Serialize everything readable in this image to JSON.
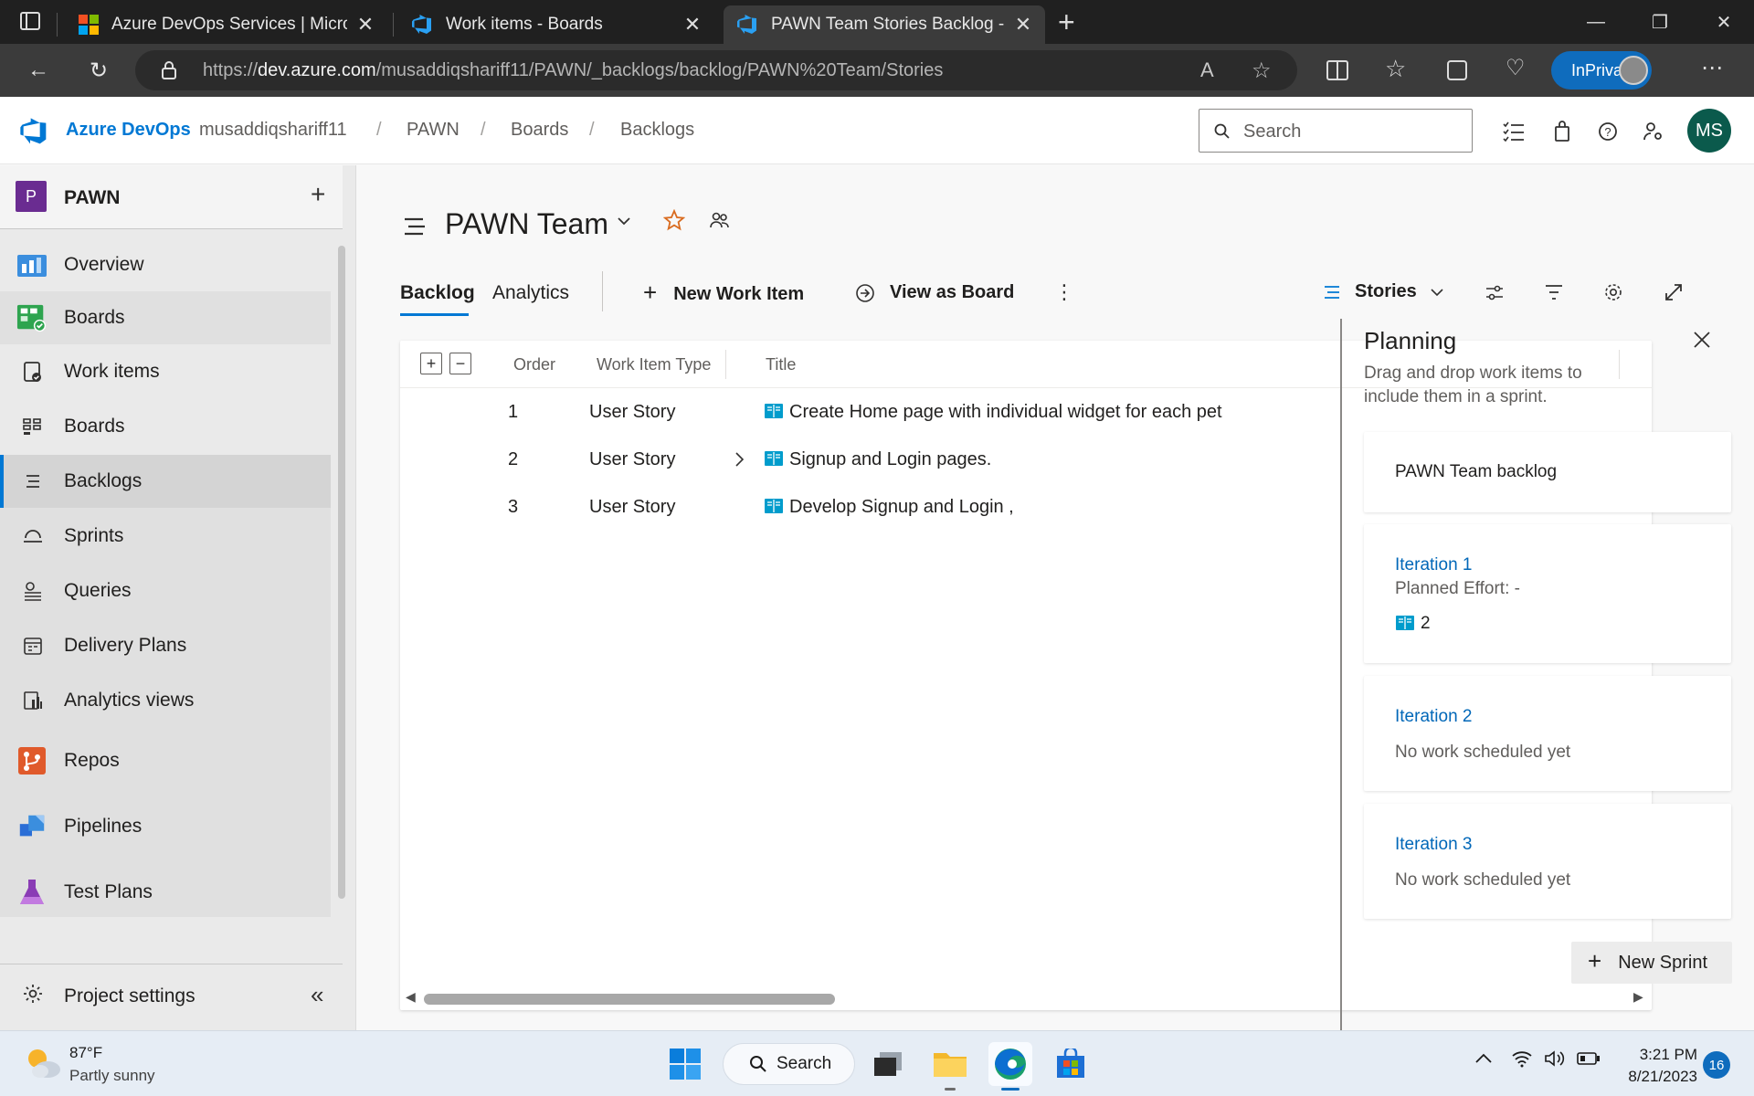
{
  "browser": {
    "tabs": [
      {
        "title": "Azure DevOps Services | Microsoft Azure",
        "icon": "microsoft-logo-icon"
      },
      {
        "title": "Work items - Boards",
        "icon": "azure-devops-icon"
      },
      {
        "title": "PAWN Team Stories Backlog - Boards",
        "icon": "azure-devops-icon",
        "active": true
      }
    ],
    "url_prefix": "https://",
    "url_domain": "dev.azure.com",
    "url_path": "/musaddiqshariff11/PAWN/_backlogs/backlog/PAWN%20Team/Stories",
    "inprivate_label": "InPrivate"
  },
  "header": {
    "brand": "Azure DevOps",
    "breadcrumb": [
      "musaddiqshariff11",
      "PAWN",
      "Boards",
      "Backlogs"
    ],
    "search_placeholder": "Search",
    "avatar_initials": "MS"
  },
  "sidebar": {
    "project_initial": "P",
    "project_name": "PAWN",
    "items": [
      {
        "label": "Overview",
        "icon": "overview-icon"
      },
      {
        "label": "Boards",
        "icon": "boards-icon"
      },
      {
        "label": "Work items",
        "icon": "work-items-icon"
      },
      {
        "label": "Boards",
        "icon": "boards-sub-icon"
      },
      {
        "label": "Backlogs",
        "icon": "backlogs-icon",
        "selected": true
      },
      {
        "label": "Sprints",
        "icon": "sprints-icon"
      },
      {
        "label": "Queries",
        "icon": "queries-icon"
      },
      {
        "label": "Delivery Plans",
        "icon": "delivery-plans-icon"
      },
      {
        "label": "Analytics views",
        "icon": "analytics-views-icon"
      },
      {
        "label": "Repos",
        "icon": "repos-icon"
      },
      {
        "label": "Pipelines",
        "icon": "pipelines-icon"
      },
      {
        "label": "Test Plans",
        "icon": "test-plans-icon"
      }
    ],
    "settings_label": "Project settings"
  },
  "main": {
    "team_name": "PAWN Team",
    "tabs": [
      "Backlog",
      "Analytics"
    ],
    "commands": {
      "new_work_item": "New Work Item",
      "view_as_board": "View as Board"
    },
    "level_selector": "Stories",
    "columns": [
      "Order",
      "Work Item Type",
      "Title"
    ],
    "rows": [
      {
        "order": "1",
        "type": "User Story",
        "title": "Create Home page with individual widget for each pet",
        "has_children": false
      },
      {
        "order": "2",
        "type": "User Story",
        "title": "Signup and Login pages.",
        "has_children": true
      },
      {
        "order": "3",
        "type": "User Story",
        "title": "Develop Signup and Login ,",
        "has_children": false
      }
    ]
  },
  "planning": {
    "title": "Planning",
    "description": "Drag and drop work items to include them in a sprint.",
    "backlog_card": "PAWN Team backlog",
    "iterations": [
      {
        "name": "Iteration 1",
        "effort": "Planned Effort: -",
        "count": "2"
      },
      {
        "name": "Iteration 2",
        "status": "No work scheduled yet"
      },
      {
        "name": "Iteration 3",
        "status": "No work scheduled yet"
      }
    ],
    "new_sprint_label": "New Sprint"
  },
  "taskbar": {
    "temperature": "87°F",
    "weather": "Partly sunny",
    "search_label": "Search",
    "time": "3:21 PM",
    "date": "8/21/2023",
    "notification_count": "16"
  },
  "colors": {
    "accent": "#0078d4",
    "project_badge": "#6a2c91",
    "avatar": "#0b5a4c",
    "story_icon": "#009ccc"
  }
}
